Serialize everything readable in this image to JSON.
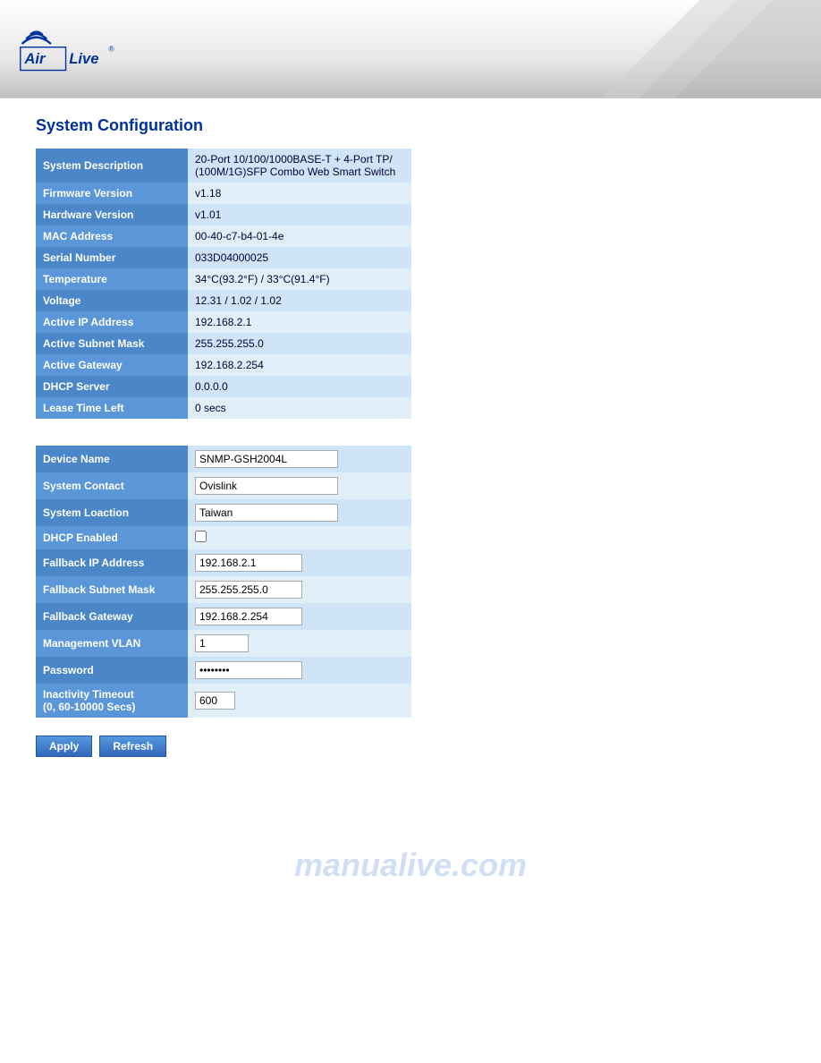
{
  "header": {
    "logo_air": "Air",
    "logo_live": "Live",
    "logo_reg": "®"
  },
  "page": {
    "title": "System Configuration"
  },
  "info_table": {
    "rows": [
      {
        "label": "System Description",
        "value": "20-Port 10/100/1000BASE-T + 4-Port TP/ (100M/1G)SFP Combo Web Smart Switch"
      },
      {
        "label": "Firmware Version",
        "value": "v1.18"
      },
      {
        "label": "Hardware Version",
        "value": "v1.01"
      },
      {
        "label": "MAC Address",
        "value": "00-40-c7-b4-01-4e"
      },
      {
        "label": "Serial Number",
        "value": "033D04000025"
      },
      {
        "label": "Temperature",
        "value": "34°C(93.2°F) / 33°C(91.4°F)"
      },
      {
        "label": "Voltage",
        "value": "12.31 / 1.02 / 1.02"
      },
      {
        "label": "Active IP Address",
        "value": "192.168.2.1"
      },
      {
        "label": "Active Subnet Mask",
        "value": "255.255.255.0"
      },
      {
        "label": "Active Gateway",
        "value": "192.168.2.254"
      },
      {
        "label": "DHCP Server",
        "value": "0.0.0.0"
      },
      {
        "label": "Lease Time Left",
        "value": "0 secs"
      }
    ]
  },
  "config_table": {
    "rows": [
      {
        "label": "Device Name",
        "field": "device_name",
        "value": "SNMP-GSH2004L",
        "type": "text",
        "width": "wide"
      },
      {
        "label": "System Contact",
        "field": "system_contact",
        "value": "Ovislink",
        "type": "text",
        "width": "wide"
      },
      {
        "label": "System Loaction",
        "field": "system_location",
        "value": "Taiwan",
        "type": "text",
        "width": "wide"
      },
      {
        "label": "DHCP Enabled",
        "field": "dhcp_enabled",
        "value": "",
        "type": "checkbox",
        "width": ""
      },
      {
        "label": "Fallback IP Address",
        "field": "fallback_ip",
        "value": "192.168.2.1",
        "type": "text",
        "width": "medium"
      },
      {
        "label": "Fallback Subnet Mask",
        "field": "fallback_subnet",
        "value": "255.255.255.0",
        "type": "text",
        "width": "medium"
      },
      {
        "label": "Fallback Gateway",
        "field": "fallback_gateway",
        "value": "192.168.2.254",
        "type": "text",
        "width": "medium"
      },
      {
        "label": "Management VLAN",
        "field": "mgmt_vlan",
        "value": "1",
        "type": "text",
        "width": "narrow"
      },
      {
        "label": "Password",
        "field": "password",
        "value": "••••••••",
        "type": "password",
        "width": "medium"
      },
      {
        "label": "Inactivity Timeout\n(0, 60-10000 Secs)",
        "field": "inactivity_timeout",
        "value": "600",
        "type": "text",
        "width": "small"
      }
    ]
  },
  "buttons": {
    "apply": "Apply",
    "refresh": "Refresh"
  },
  "watermark": {
    "text": "manualive.com"
  }
}
